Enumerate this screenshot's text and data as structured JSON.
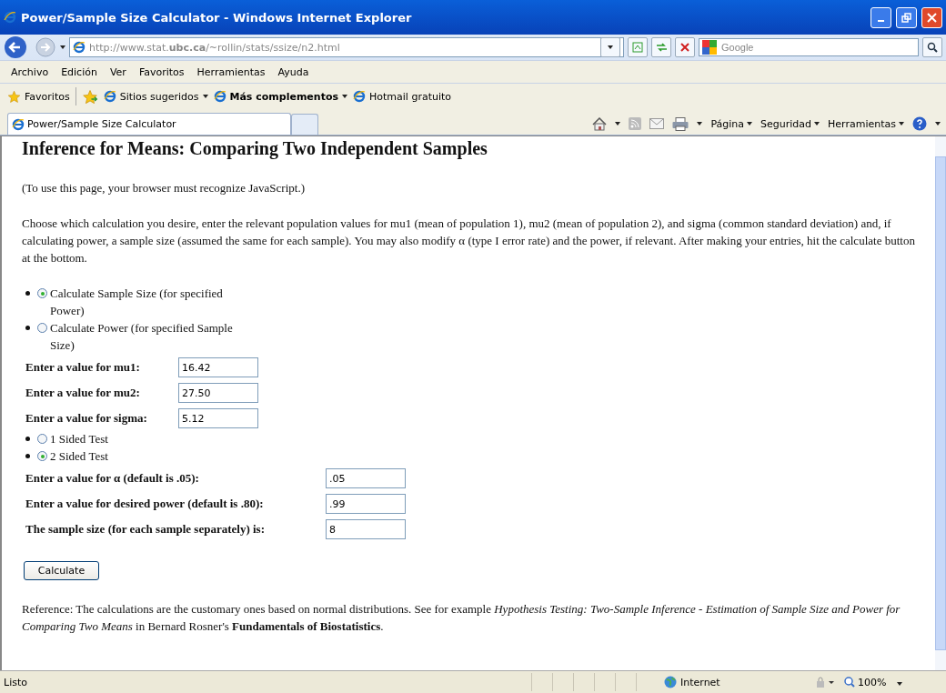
{
  "window": {
    "title": "Power/Sample Size Calculator - Windows Internet Explorer"
  },
  "address_bar": {
    "url": "http://www.stat.**ubc.ca**/~rollin/stats/ssize/n2.html"
  },
  "search": {
    "placeholder": "Google"
  },
  "menu": [
    "Archivo",
    "Edición",
    "Ver",
    "Favoritos",
    "Herramientas",
    "Ayuda"
  ],
  "favorites_bar": {
    "favorites": "Favoritos",
    "links": [
      {
        "label": "Sitios sugeridos",
        "dropdown": true,
        "bold": false
      },
      {
        "label": "Más complementos",
        "dropdown": true,
        "bold": true
      },
      {
        "label": "Hotmail gratuito",
        "dropdown": false,
        "bold": false
      }
    ]
  },
  "tabs": [
    {
      "label": "Power/Sample Size Calculator",
      "selected": true
    }
  ],
  "command_bar": [
    "Página",
    "Seguridad",
    "Herramientas"
  ],
  "page": {
    "heading": "Inference for Means: Comparing Two Independent Samples",
    "note": "(To use this page, your browser must recognize JavaScript.)",
    "intro": "Choose which calculation you desire, enter the relevant population values for mu1 (mean of population 1), mu2 (mean of population 2), and sigma (common standard deviation) and, if calculating power, a sample size (assumed the same for each sample). You may also modify α (type I error rate) and the power, if relevant. After making your entries, hit the calculate button at the bottom.",
    "mode_options": [
      {
        "label": "Calculate Sample Size (for specified Power)",
        "selected": true
      },
      {
        "label": "Calculate Power (for specified Sample Size)",
        "selected": false
      }
    ],
    "population_fields": [
      {
        "label": "Enter a value for mu1:",
        "value": "16.42"
      },
      {
        "label": "Enter a value for mu2:",
        "value": "27.50"
      },
      {
        "label": "Enter a value for sigma:",
        "value": "5.12"
      }
    ],
    "test_options": [
      {
        "label": "1 Sided Test",
        "selected": false
      },
      {
        "label": "2 Sided Test",
        "selected": true
      }
    ],
    "setting_fields": [
      {
        "label": "Enter a value for α (default is .05):",
        "value": ".05"
      },
      {
        "label": "Enter a value for desired power (default is .80):",
        "value": ".99"
      },
      {
        "label": "The sample size (for each sample separately) is:",
        "value": "8"
      }
    ],
    "button": "Calculate",
    "reference": "Reference: The calculations are the customary ones based on normal distributions. See for example *Hypothesis Testing: Two-Sample Inference - Estimation of Sample Size and Power for Comparing Two Means* in Bernard Rosner's **Fundamentals of Biostatistics**."
  },
  "status_bar": {
    "status": "Listo",
    "zone": "Internet",
    "zoom": "100%"
  }
}
